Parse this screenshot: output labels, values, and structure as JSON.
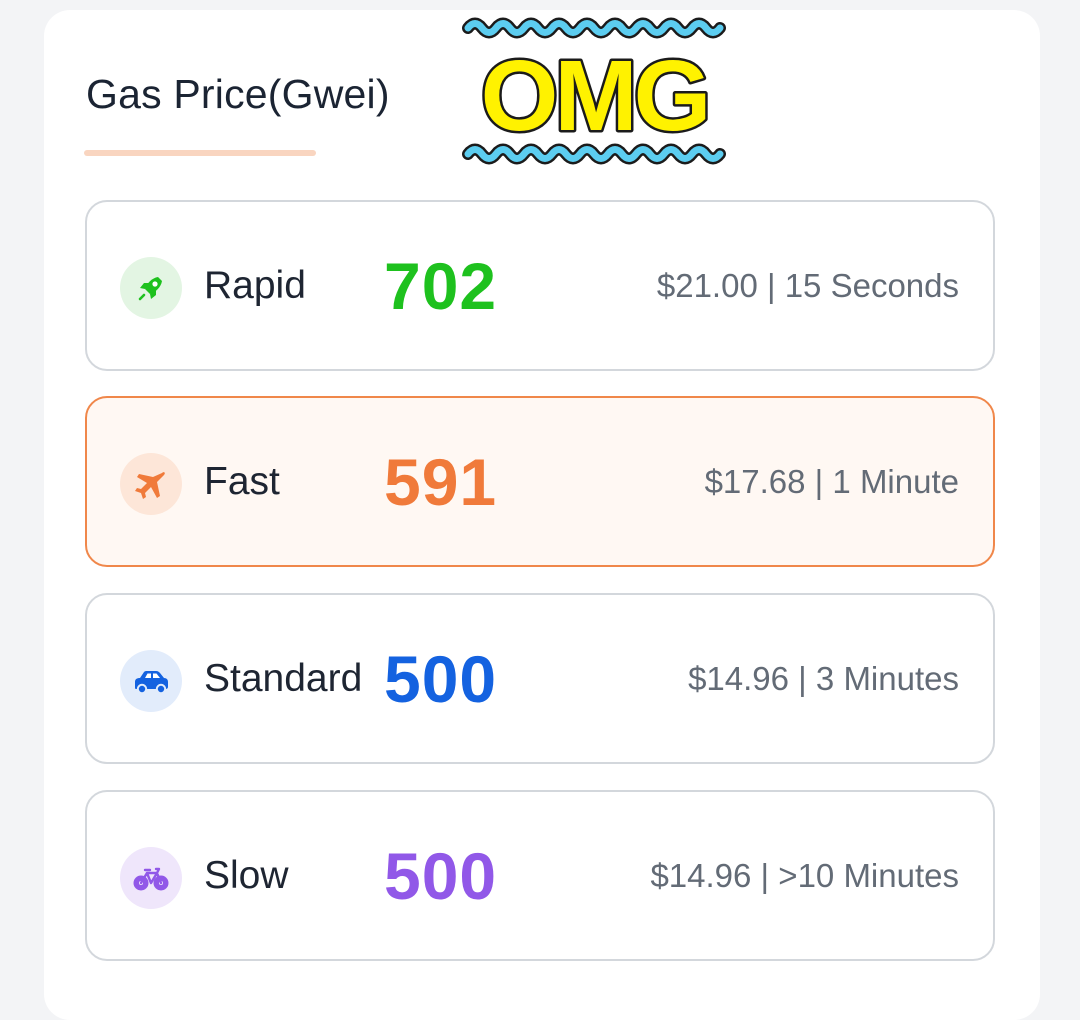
{
  "header": {
    "title": "Gas Price(Gwei)",
    "sticker_text": "OMG"
  },
  "tiers": [
    {
      "name": "Rapid",
      "price": "702",
      "meta": "$21.00 | 15 Seconds",
      "icon": "rocket-icon",
      "color": "#1ec11e",
      "icon_bg": "#e3f5e3",
      "selected": false
    },
    {
      "name": "Fast",
      "price": "591",
      "meta": "$17.68 | 1 Minute",
      "icon": "airplane-icon",
      "color": "#f07a3a",
      "icon_bg": "#fde6d8",
      "selected": true
    },
    {
      "name": "Standard",
      "price": "500",
      "meta": "$14.96 | 3 Minutes",
      "icon": "car-icon",
      "color": "#1462e0",
      "icon_bg": "#e2ecfb",
      "selected": false
    },
    {
      "name": "Slow",
      "price": "500",
      "meta": "$14.96 | >10 Minutes",
      "icon": "bicycle-icon",
      "color": "#9158e8",
      "icon_bg": "#efe6fb",
      "selected": false
    }
  ]
}
